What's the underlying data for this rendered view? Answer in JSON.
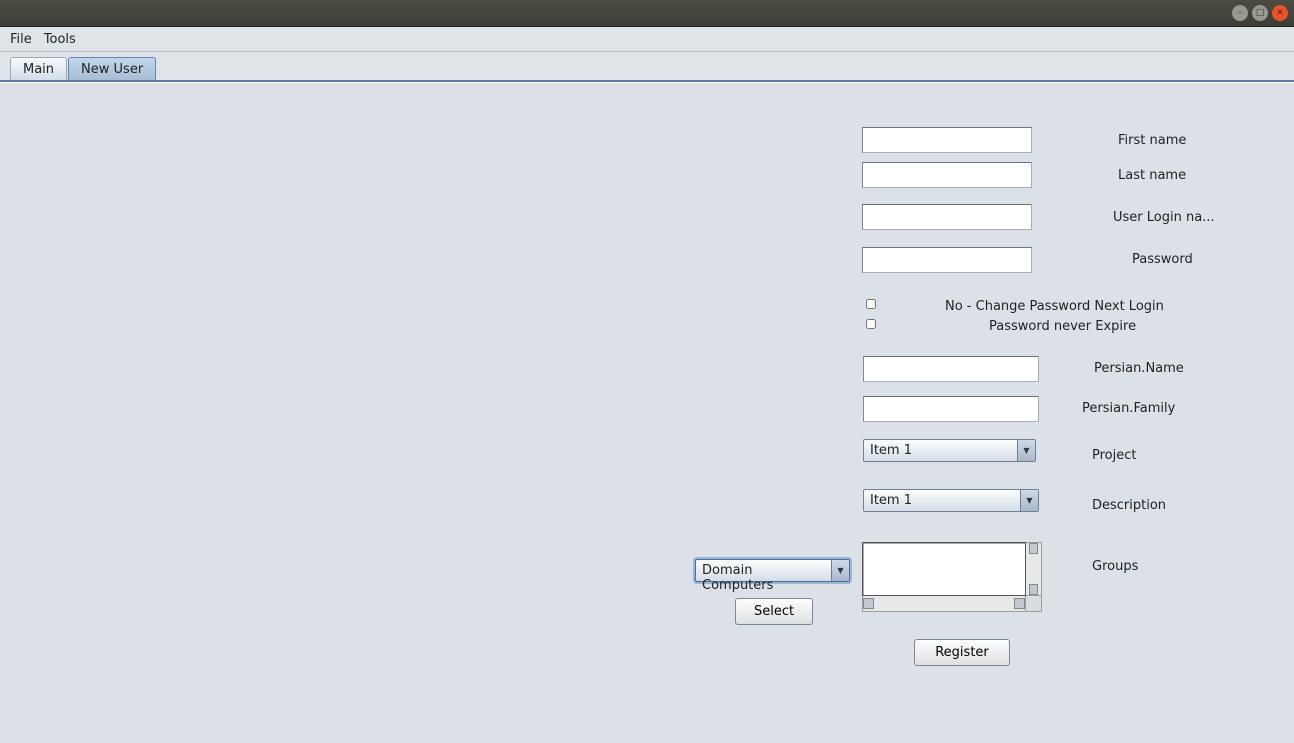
{
  "window": {
    "title": ""
  },
  "menu": {
    "file": "File",
    "tools": "Tools"
  },
  "tabs": {
    "main": "Main",
    "new_user": "New User"
  },
  "form": {
    "first_name_label": "First name",
    "first_name_value": "",
    "last_name_label": "Last name",
    "last_name_value": "",
    "user_login_label": "User Login na...",
    "user_login_value": "",
    "password_label": "Password",
    "password_value": "",
    "chk_no_change_label": "No - Change Password Next Login",
    "chk_no_change_checked": false,
    "chk_never_expire_label": "Password never Expire",
    "chk_never_expire_checked": false,
    "persian_name_label": "Persian.Name",
    "persian_name_value": "",
    "persian_family_label": "Persian.Family",
    "persian_family_value": "",
    "project_label": "Project",
    "project_value": "Item 1",
    "description_label": "Description",
    "description_value": "Item 1",
    "groups_label": "Groups",
    "domain_combo_value": "Domain Computers",
    "select_button": "Select",
    "register_button": "Register"
  }
}
